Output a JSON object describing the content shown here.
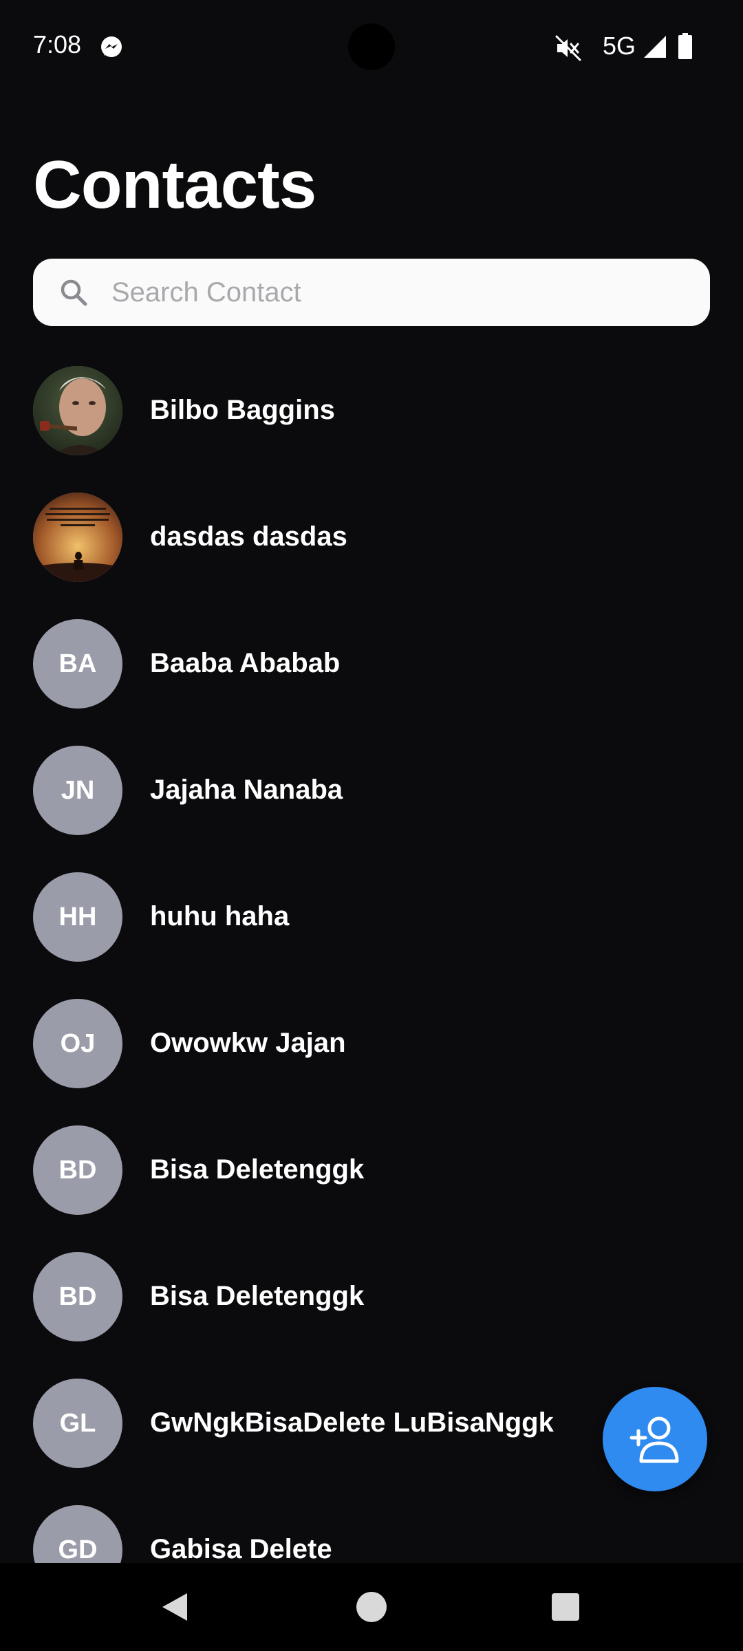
{
  "status_bar": {
    "time": "7:08",
    "network": "5G",
    "icons": [
      "messenger-icon",
      "mute-icon",
      "signal-icon",
      "battery-icon"
    ]
  },
  "header": {
    "title": "Contacts"
  },
  "search": {
    "placeholder": "Search Contact",
    "value": ""
  },
  "contacts": [
    {
      "name": "Bilbo Baggins",
      "initials": "",
      "avatar": "photo-portrait"
    },
    {
      "name": "dasdas dasdas",
      "initials": "",
      "avatar": "photo-sunset-quote"
    },
    {
      "name": "Baaba Ababab",
      "initials": "BA",
      "avatar": "initials"
    },
    {
      "name": "Jajaha Nanaba",
      "initials": "JN",
      "avatar": "initials"
    },
    {
      "name": "huhu haha",
      "initials": "HH",
      "avatar": "initials"
    },
    {
      "name": "Owowkw Jajan",
      "initials": "OJ",
      "avatar": "initials"
    },
    {
      "name": "Bisa Deletenggk",
      "initials": "BD",
      "avatar": "initials"
    },
    {
      "name": "Bisa Deletenggk",
      "initials": "BD",
      "avatar": "initials"
    },
    {
      "name": "GwNgkBisaDelete LuBisaNggk",
      "initials": "GL",
      "avatar": "initials"
    },
    {
      "name": "Gabisa Delete",
      "initials": "GD",
      "avatar": "initials"
    }
  ],
  "fab": {
    "icon": "add-person-icon"
  },
  "nav_bar": {
    "icons": [
      "back-icon",
      "home-icon",
      "recents-icon"
    ]
  },
  "colors": {
    "background": "#0b0b0e",
    "avatar_placeholder": "#9b9ca9",
    "fab": "#2f8bef",
    "search_background": "#fafafa",
    "placeholder_text": "#a9a9ad"
  }
}
